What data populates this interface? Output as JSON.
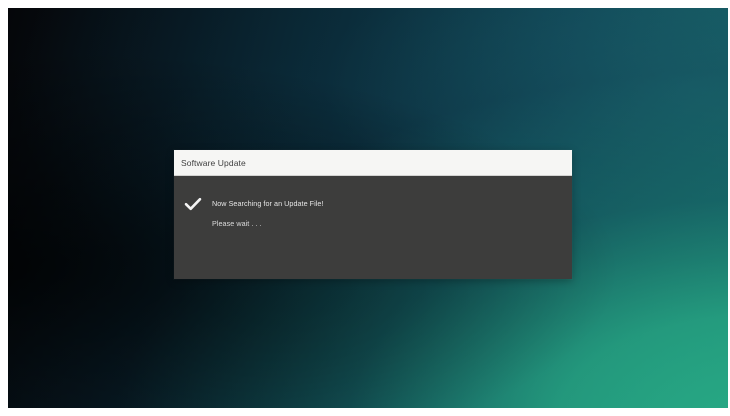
{
  "dialog": {
    "title": "Software Update",
    "messages": [
      "Now Searching for an Update File!",
      "Please wait . . ."
    ],
    "status_icon": "check-icon"
  },
  "colors": {
    "dialog_header": "#f6f6f4",
    "dialog_body": "#3d3d3c",
    "text_primary": "#e6e6e6",
    "background_dark": "#050609",
    "background_teal": "#27a984"
  }
}
